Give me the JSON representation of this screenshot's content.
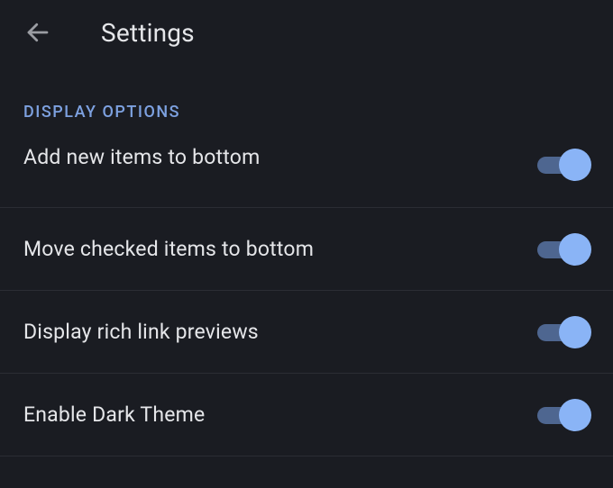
{
  "header": {
    "title": "Settings"
  },
  "section": {
    "header": "Display Options"
  },
  "settings": {
    "items": [
      {
        "label": "Add new items to bottom",
        "enabled": true
      },
      {
        "label": "Move checked items to bottom",
        "enabled": true
      },
      {
        "label": "Display rich link previews",
        "enabled": true
      },
      {
        "label": "Enable Dark Theme",
        "enabled": true
      }
    ]
  },
  "colors": {
    "background": "#1a1c22",
    "text": "#e5e6e9",
    "accent": "#8ab4f6",
    "section_header": "#7da1e0",
    "divider": "#2b2d34",
    "toggle_track": "#4e6690"
  }
}
